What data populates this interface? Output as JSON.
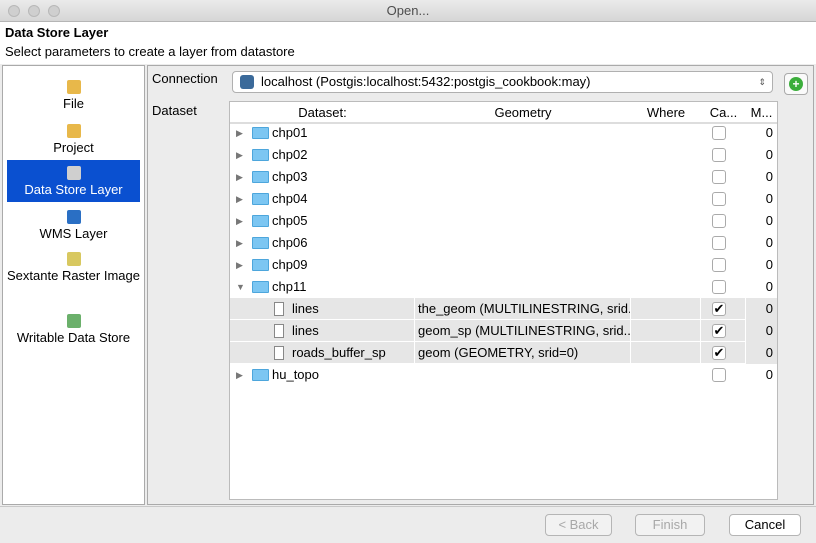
{
  "window": {
    "title": "Open..."
  },
  "header": {
    "title": "Data Store Layer",
    "subtitle": "Select parameters to create a layer from datastore"
  },
  "nav": [
    {
      "label": "File",
      "icon": "file-icon",
      "color": "#e8b84a"
    },
    {
      "label": "Project",
      "icon": "project-icon",
      "color": "#e8b84a"
    },
    {
      "label": "Data Store Layer",
      "icon": "database-add-icon",
      "color": "#cfcfcf",
      "selected": true
    },
    {
      "label": "WMS Layer",
      "icon": "globe-icon",
      "color": "#2a6fc4"
    },
    {
      "label": "Sextante Raster Image",
      "icon": "raster-icon",
      "color": "#d8c860"
    },
    {
      "label": "Writable Data Store",
      "icon": "writable-store-icon",
      "color": "#6bb06b"
    }
  ],
  "form": {
    "connection_label": "Connection",
    "connection_value": "localhost   (Postgis:localhost:5432:postgis_cookbook:may)",
    "dataset_label": "Dataset"
  },
  "table": {
    "columns": [
      "Dataset:",
      "Geometry",
      "Where",
      "Ca...",
      "M..."
    ],
    "rows": [
      {
        "name": "chp01",
        "type": "folder",
        "expanded": false,
        "checked": false,
        "count": "0"
      },
      {
        "name": "chp02",
        "type": "folder",
        "expanded": false,
        "checked": false,
        "count": "0"
      },
      {
        "name": "chp03",
        "type": "folder",
        "expanded": false,
        "checked": false,
        "count": "0"
      },
      {
        "name": "chp04",
        "type": "folder",
        "expanded": false,
        "checked": false,
        "count": "0"
      },
      {
        "name": "chp05",
        "type": "folder",
        "expanded": false,
        "checked": false,
        "count": "0"
      },
      {
        "name": "chp06",
        "type": "folder",
        "expanded": false,
        "checked": false,
        "count": "0"
      },
      {
        "name": "chp09",
        "type": "folder",
        "expanded": false,
        "checked": false,
        "count": "0"
      },
      {
        "name": "chp11",
        "type": "folder",
        "expanded": true,
        "checked": false,
        "count": "0"
      },
      {
        "name": "lines",
        "type": "table",
        "geometry": "the_geom (MULTILINESTRING, srid...",
        "where": "",
        "checked": true,
        "count": "0"
      },
      {
        "name": "lines",
        "type": "table",
        "geometry": "geom_sp (MULTILINESTRING, srid...",
        "where": "",
        "checked": true,
        "count": "0"
      },
      {
        "name": "roads_buffer_sp",
        "type": "table",
        "geometry": "geom (GEOMETRY, srid=0)",
        "where": "",
        "checked": true,
        "count": "0"
      },
      {
        "name": "hu_topo",
        "type": "folder",
        "expanded": false,
        "checked": false,
        "count": "0"
      }
    ]
  },
  "buttons": {
    "back": "< Back",
    "finish": "Finish",
    "cancel": "Cancel"
  }
}
